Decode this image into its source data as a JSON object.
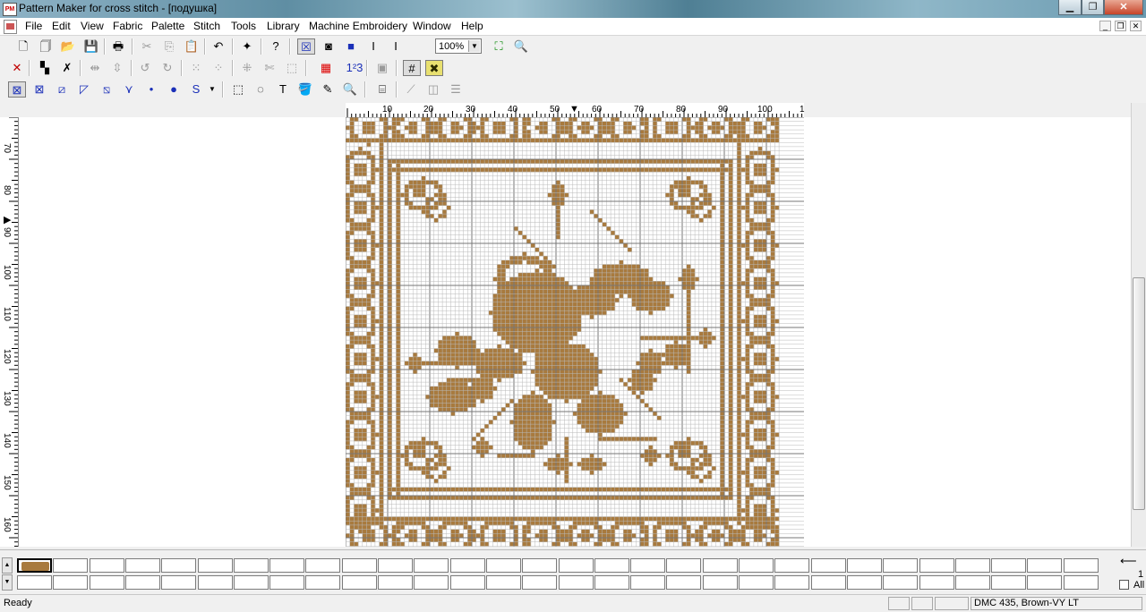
{
  "window": {
    "title": "Pattern Maker for cross stitch - [подушка]",
    "app_icon": "PM",
    "buttons": [
      "minimize-icon",
      "maximize-icon",
      "close-icon"
    ]
  },
  "menu": [
    "File",
    "Edit",
    "View",
    "Fabric",
    "Palette",
    "Stitch",
    "Tools",
    "Library",
    "Machine Embroidery",
    "Window",
    "Help"
  ],
  "toolbar": {
    "zoom": "100%"
  },
  "ruler": {
    "h_labels": [
      "10",
      "20",
      "30",
      "40",
      "50",
      "60",
      "70",
      "80",
      "90",
      "100",
      "1"
    ],
    "v_labels": [
      "70",
      "80",
      "90",
      "100",
      "110",
      "120",
      "130",
      "140",
      "150",
      "160"
    ],
    "h_marker": "▼",
    "v_marker": "▶"
  },
  "pattern": {
    "thread_color": "#a87a3e",
    "grid_color": "#b9b9b9",
    "major_grid_color": "#777777"
  },
  "palette": {
    "selected_color": "#a87a3e",
    "page": "1",
    "all_label": "All"
  },
  "status": {
    "ready": "Ready",
    "thread": "DMC  435, Brown-VY LT"
  }
}
